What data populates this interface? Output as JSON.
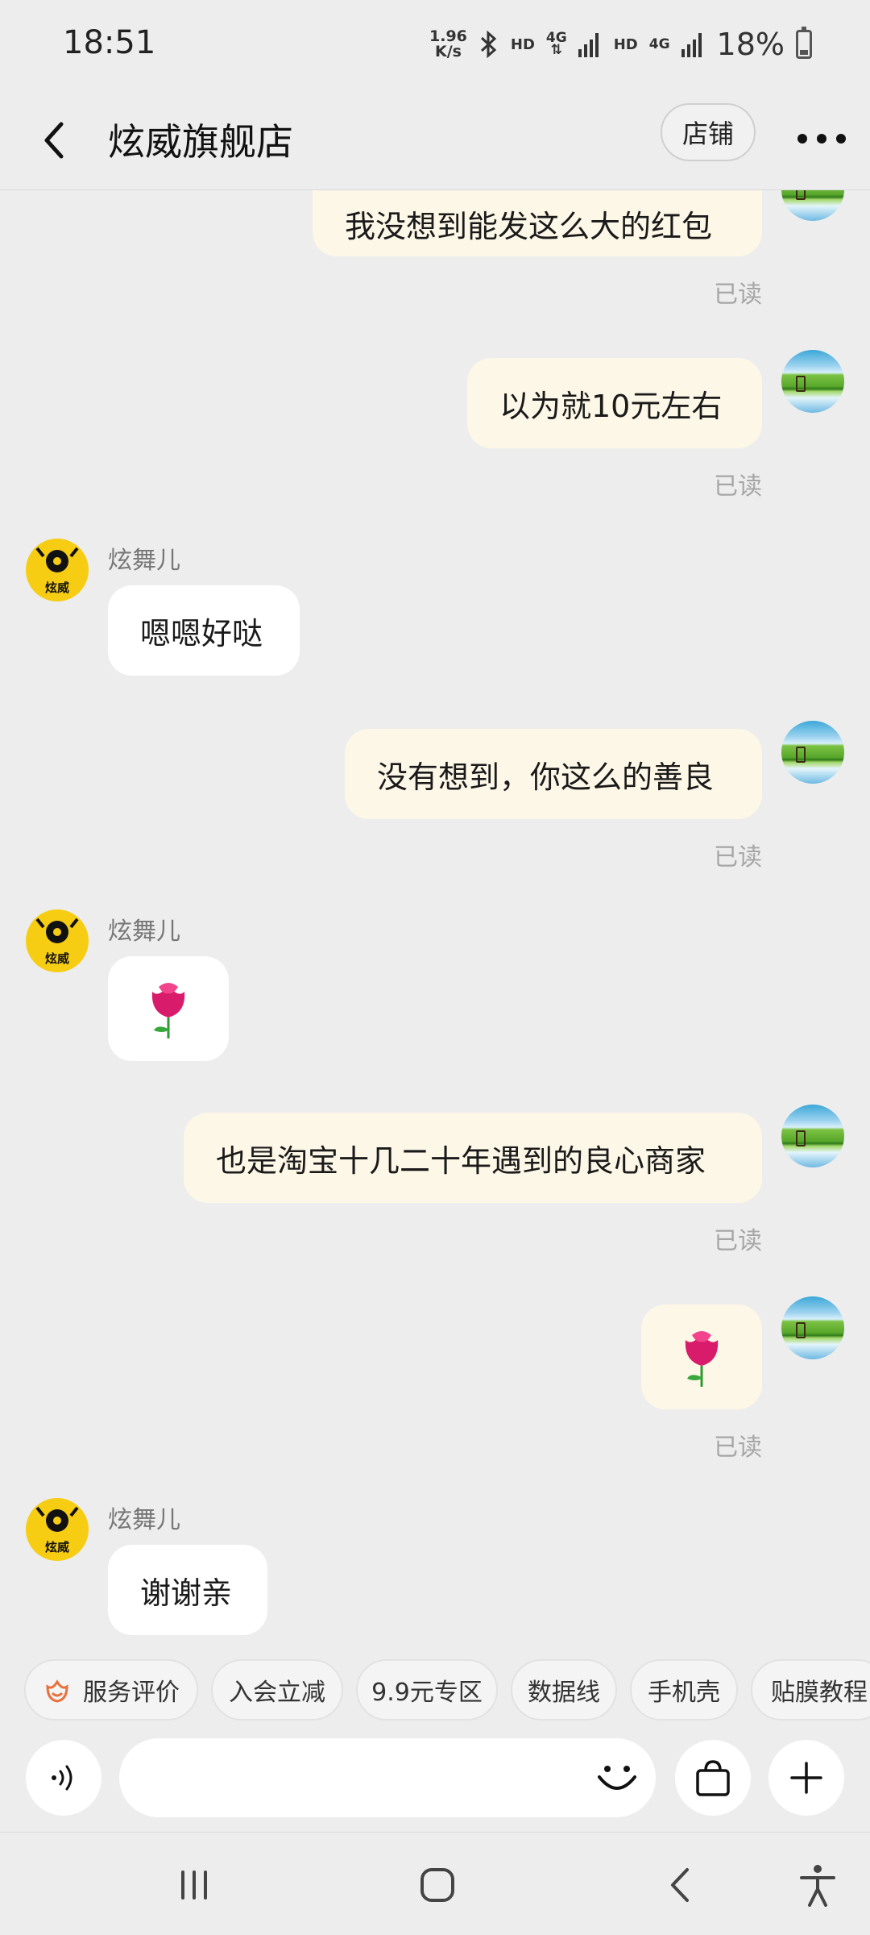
{
  "status_bar": {
    "time": "18:51",
    "net_speed_value": "1.96",
    "net_speed_unit": "K/s",
    "hd1": "HD",
    "g4_1": "4G",
    "hd2": "HD",
    "g4_2": "4G",
    "battery": "18%"
  },
  "header": {
    "title": "炫威旗舰店",
    "shop_label": "店铺"
  },
  "messages": [
    {
      "from": "me",
      "text": "我没想到能发这么大的红包",
      "status": "已读"
    },
    {
      "from": "me",
      "text": "以为就10元左右",
      "status": "已读"
    },
    {
      "from": "them",
      "sender": "炫舞儿",
      "text": "嗯嗯好哒"
    },
    {
      "from": "me",
      "text": "没有想到，你这么的善良",
      "status": "已读"
    },
    {
      "from": "them",
      "sender": "炫舞儿",
      "sticker": "rose"
    },
    {
      "from": "me",
      "text": "也是淘宝十几二十年遇到的良心商家",
      "status": "已读"
    },
    {
      "from": "me",
      "sticker": "rose",
      "status": "已读"
    },
    {
      "from": "them",
      "sender": "炫舞儿",
      "text": "谢谢亲"
    }
  ],
  "shop_avatar_text": "炫威",
  "quick_chips": [
    {
      "label": "服务评价",
      "icon": "service-icon"
    },
    {
      "label": "入会立减"
    },
    {
      "label": "9.9元专区"
    },
    {
      "label": "数据线"
    },
    {
      "label": "手机壳"
    },
    {
      "label": "贴膜教程"
    }
  ],
  "input": {
    "placeholder": "",
    "voice_icon": "voice-icon",
    "emoji_icon": "emoji-icon",
    "bag_icon": "shopping-bag-icon",
    "plus_icon": "plus-icon"
  },
  "colors": {
    "background": "#ededed",
    "my_bubble": "#fdf7e7",
    "their_bubble": "#ffffff",
    "shop_avatar": "#f7cd13",
    "chip_icon": "#e8703a"
  }
}
